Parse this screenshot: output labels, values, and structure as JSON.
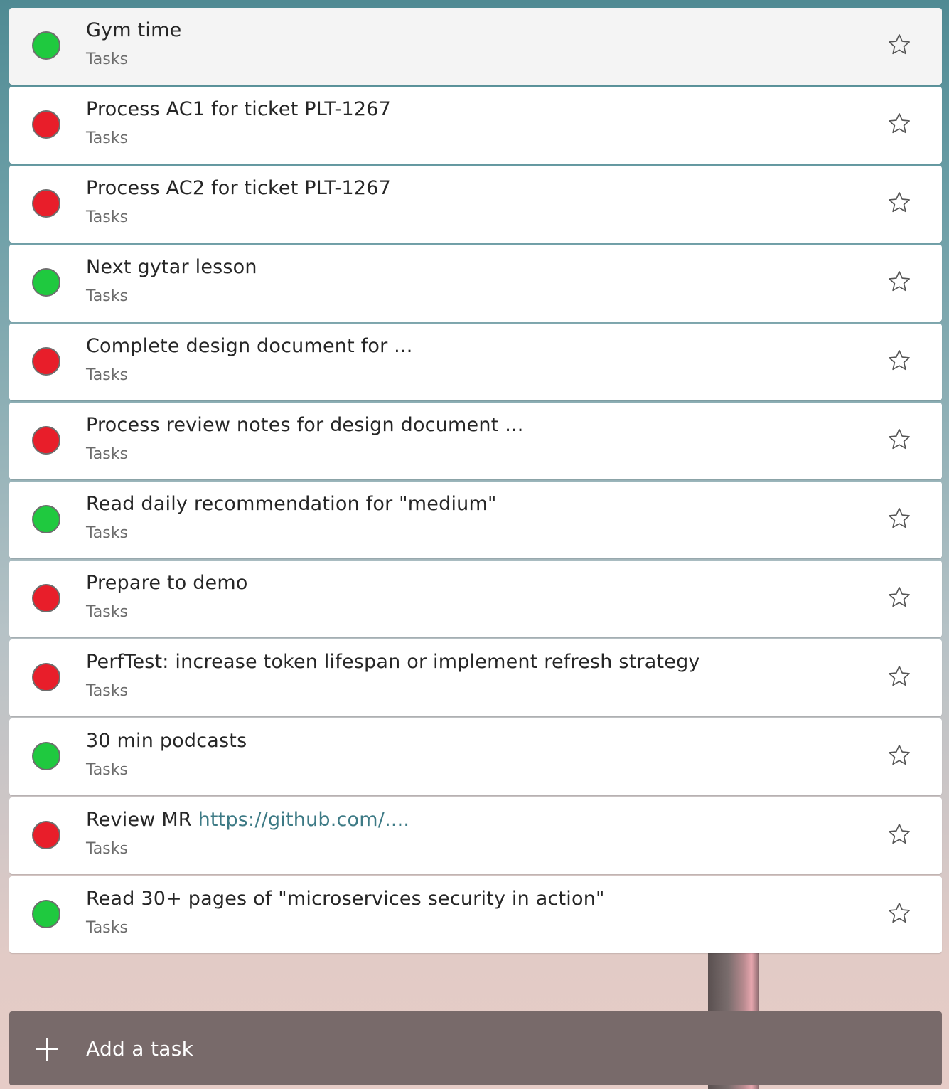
{
  "tasks": [
    {
      "title": "Gym time",
      "list": "Tasks",
      "status": "green"
    },
    {
      "title": "Process AC1 for ticket PLT-1267",
      "list": "Tasks",
      "status": "red"
    },
    {
      "title": "Process AC2 for ticket PLT-1267",
      "list": "Tasks",
      "status": "red"
    },
    {
      "title": "Next gytar lesson",
      "list": "Tasks",
      "status": "green"
    },
    {
      "title": "Complete design document for ...",
      "list": "Tasks",
      "status": "red"
    },
    {
      "title": "Process review notes for design document ...",
      "list": "Tasks",
      "status": "red"
    },
    {
      "title": "Read daily recommendation for \"medium\"",
      "list": "Tasks",
      "status": "green"
    },
    {
      "title": "Prepare to demo",
      "list": "Tasks",
      "status": "red"
    },
    {
      "title": "PerfTest: increase token lifespan or implement refresh strategy",
      "list": "Tasks",
      "status": "red"
    },
    {
      "title": "30 min podcasts",
      "list": "Tasks",
      "status": "green"
    },
    {
      "title": "Review MR ",
      "link": "https://github.com/....",
      "list": "Tasks",
      "status": "red"
    },
    {
      "title": "Read 30+ pages of \"microservices security in action\"",
      "list": "Tasks",
      "status": "green"
    }
  ],
  "add_task": {
    "label": "Add a task",
    "icon": "plus-icon"
  },
  "colors": {
    "green": "#1fc93f",
    "red": "#e81e2a",
    "link": "#3d7a85",
    "add_bar": "#786a6a"
  },
  "icons": {
    "star": "star-outline-icon",
    "status": "status-circle-icon"
  }
}
